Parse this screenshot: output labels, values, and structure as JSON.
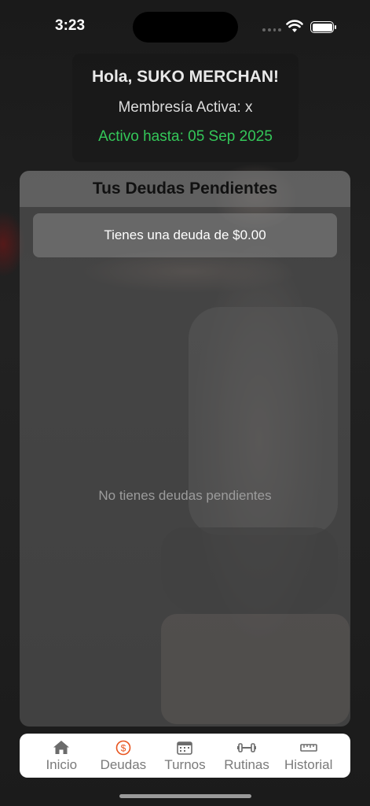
{
  "status_bar": {
    "time": "3:23"
  },
  "greeting": {
    "title": "Hola, SUKO MERCHAN!",
    "membership": "Membresía Activa: x",
    "active_until": "Activo hasta: 05 Sep 2025"
  },
  "debts": {
    "title": "Tus Deudas Pendientes",
    "summary": "Tienes una deuda de $0.00",
    "empty_message": "No tienes deudas pendientes"
  },
  "tabs": [
    {
      "label": "Inicio",
      "icon": "house-icon"
    },
    {
      "label": "Deudas",
      "icon": "dollar-circle-icon",
      "active": true
    },
    {
      "label": "Turnos",
      "icon": "calendar-icon"
    },
    {
      "label": "Rutinas",
      "icon": "dumbbell-icon"
    },
    {
      "label": "Historial",
      "icon": "ruler-icon"
    }
  ],
  "colors": {
    "active_green": "#34c759",
    "accent_orange": "#e8541e"
  }
}
